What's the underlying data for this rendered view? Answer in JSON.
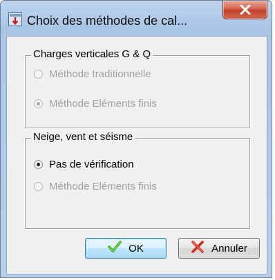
{
  "window": {
    "title": "Choix des méthodes de cal...",
    "accent": "#bfd6ee",
    "close_color": "#c2402a"
  },
  "group_vertical": {
    "legend": "Charges verticales G & Q",
    "options": [
      {
        "label": "Méthode traditionnelle",
        "selected": false,
        "enabled": false
      },
      {
        "label": "Méthode Eléments finis",
        "selected": true,
        "enabled": false
      }
    ]
  },
  "group_snow": {
    "legend": "Neige, vent et séisme",
    "options": [
      {
        "label": "Pas de vérification",
        "selected": true,
        "enabled": true
      },
      {
        "label": "Méthode Eléments finis",
        "selected": false,
        "enabled": false
      }
    ]
  },
  "buttons": {
    "ok": {
      "label": "OK",
      "icon": "check-icon"
    },
    "cancel": {
      "label": "Annuler",
      "icon": "cross-icon"
    }
  }
}
